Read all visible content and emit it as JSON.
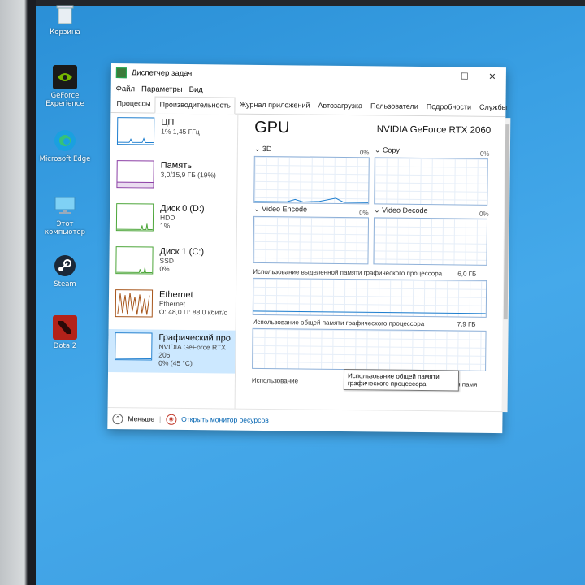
{
  "desktop": {
    "icons": [
      {
        "label": "Корзина",
        "icon": "recycle-bin-icon"
      },
      {
        "label": "GeForce Experience",
        "icon": "nvidia-icon"
      },
      {
        "label": "Microsoft Edge",
        "icon": "edge-icon"
      },
      {
        "label": "Этот компьютер",
        "icon": "computer-icon"
      },
      {
        "label": "Steam",
        "icon": "steam-icon"
      },
      {
        "label": "Dota 2",
        "icon": "dota2-icon"
      }
    ]
  },
  "window": {
    "title": "Диспетчер задач",
    "controls": {
      "minimize": "—",
      "maximize": "☐",
      "close": "✕"
    },
    "menu": [
      "Файл",
      "Параметры",
      "Вид"
    ],
    "tabs": [
      "Процессы",
      "Производительность",
      "Журнал приложений",
      "Автозагрузка",
      "Пользователи",
      "Подробности",
      "Службы"
    ],
    "active_tab": "Производительность"
  },
  "resources": [
    {
      "name": "ЦП",
      "line2": "1% 1,45 ГГц",
      "line3": "",
      "color": "#1f7fcf"
    },
    {
      "name": "Память",
      "line2": "3,0/15,9 ГБ (19%)",
      "line3": "",
      "color": "#8b3ea5"
    },
    {
      "name": "Диск 0 (D:)",
      "line2": "HDD",
      "line3": "1%",
      "color": "#4da63a"
    },
    {
      "name": "Диск 1 (C:)",
      "line2": "SSD",
      "line3": "0%",
      "color": "#4da63a"
    },
    {
      "name": "Ethernet",
      "line2": "Ethernet",
      "line3": "О: 48,0 П: 88,0 кбит/с",
      "color": "#a7561c"
    },
    {
      "name": "Графический про",
      "line2": "NVIDIA GeForce RTX 206",
      "line3": "0% (45 °C)",
      "color": "#1f7fcf"
    }
  ],
  "gpu": {
    "title": "GPU",
    "model": "NVIDIA GeForce RTX 2060",
    "engines": [
      {
        "label": "3D",
        "pct": "0%"
      },
      {
        "label": "Copy",
        "pct": "0%"
      },
      {
        "label": "Video Encode",
        "pct": "0%"
      },
      {
        "label": "Video Decode",
        "pct": "0%"
      }
    ],
    "dedicated_label": "Использование выделенной памяти графического процессора",
    "dedicated_max": "6,0 ГБ",
    "shared_label": "Использование общей памяти графического процессора",
    "shared_max": "7,9 ГБ",
    "usage_label": "Использование",
    "dedicated_short": "Выделенная памя",
    "tooltip": "Использование общей памяти графического процессора"
  },
  "footer": {
    "less": "Меньше",
    "monitor": "Открыть монитор ресурсов"
  }
}
